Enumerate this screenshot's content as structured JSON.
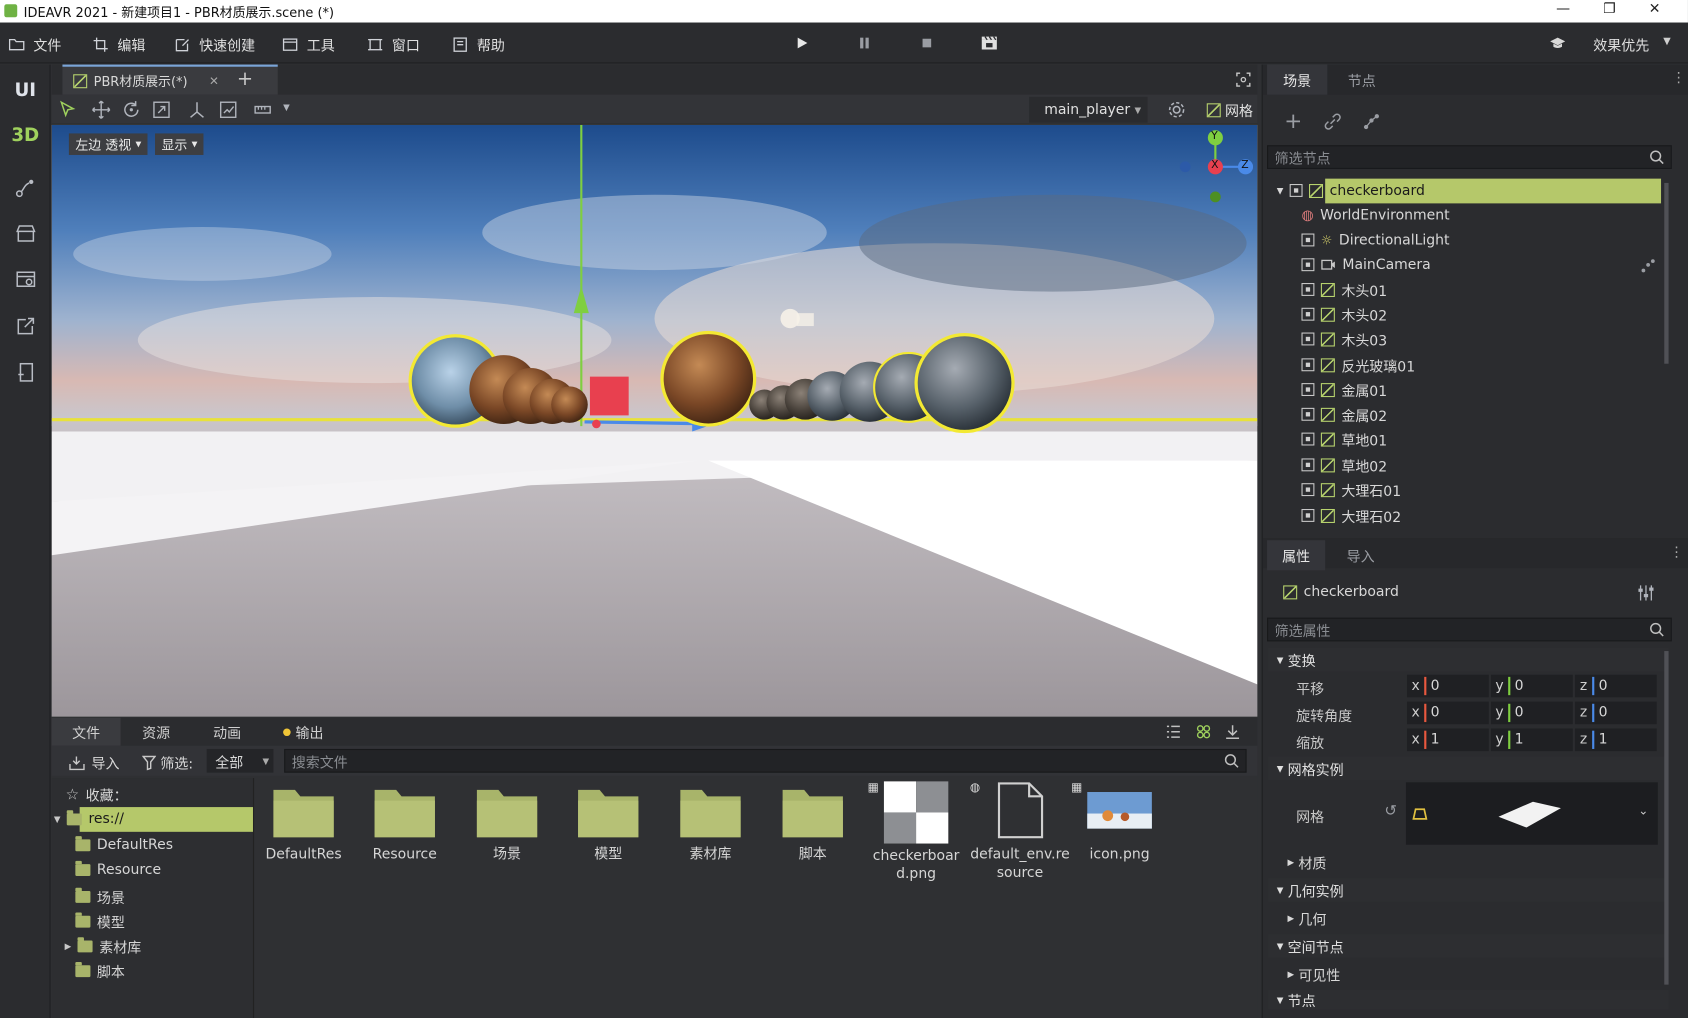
{
  "window": {
    "title": "IDEAVR 2021 - 新建项目1 - PBR材质展示.scene (*)",
    "minimize": "—",
    "maximize": "❐",
    "close": "✕"
  },
  "menu": {
    "items": [
      "文件",
      "编辑",
      "快速创建",
      "工具",
      "窗口",
      "帮助"
    ],
    "render_mode": "效果优先"
  },
  "leftbar": {
    "ui_label": "UI",
    "3d_label": "3D"
  },
  "editor": {
    "tab_label": "PBR材质展示(*)",
    "tab_close": "✕",
    "add_tab": "+",
    "player": "main_player",
    "grid_label": "网格",
    "view_mode": "左边 透视",
    "display_label": "显示",
    "gizmo": {
      "y": "Y",
      "x": "X",
      "z": "Z"
    }
  },
  "bottom": {
    "tabs": [
      "文件",
      "资源",
      "动画",
      "输出"
    ],
    "import_label": "导入",
    "filter_label": "筛选:",
    "filter_value": "全部",
    "search_placeholder": "搜索文件",
    "favorites_label": "收藏：",
    "tree": [
      "res://",
      "DefaultRes",
      "Resource",
      "场景",
      "模型",
      "素材库",
      "脚本"
    ],
    "files": [
      {
        "name": "DefaultRes",
        "kind": "folder"
      },
      {
        "name": "Resource",
        "kind": "folder"
      },
      {
        "name": "场景",
        "kind": "folder"
      },
      {
        "name": "模型",
        "kind": "folder"
      },
      {
        "name": "素材库",
        "kind": "folder"
      },
      {
        "name": "脚本",
        "kind": "folder"
      },
      {
        "name": "checkerboard.png",
        "kind": "image"
      },
      {
        "name": "default_env.resource",
        "kind": "resource"
      },
      {
        "name": "icon.png",
        "kind": "image"
      }
    ]
  },
  "scene": {
    "tabs": [
      "场景",
      "节点"
    ],
    "filter_placeholder": "筛选节点",
    "nodes": [
      {
        "name": "checkerboard",
        "icon": "mesh-icon",
        "selected": true
      },
      {
        "name": "WorldEnvironment",
        "icon": "globe-icon"
      },
      {
        "name": "DirectionalLight",
        "icon": "sun-icon"
      },
      {
        "name": "MainCamera",
        "icon": "camera-icon"
      },
      {
        "name": "木头01",
        "icon": "mesh-icon"
      },
      {
        "name": "木头02",
        "icon": "mesh-icon"
      },
      {
        "name": "木头03",
        "icon": "mesh-icon"
      },
      {
        "name": "反光玻璃01",
        "icon": "mesh-icon"
      },
      {
        "name": "金属01",
        "icon": "mesh-icon"
      },
      {
        "name": "金属02",
        "icon": "mesh-icon"
      },
      {
        "name": "草地01",
        "icon": "mesh-icon"
      },
      {
        "name": "草地02",
        "icon": "mesh-icon"
      },
      {
        "name": "大理石01",
        "icon": "mesh-icon"
      },
      {
        "name": "大理石02",
        "icon": "mesh-icon"
      }
    ]
  },
  "inspector": {
    "tabs": [
      "属性",
      "导入"
    ],
    "object_name": "checkerboard",
    "filter_placeholder": "筛选属性",
    "sections": {
      "transform": "变换",
      "mesh_instance": "网格实例",
      "material": "材质",
      "geometry_instance": "几何实例",
      "geometry": "几何",
      "spatial": "空间节点",
      "visibility": "可见性",
      "node": "节点"
    },
    "props": {
      "translation": {
        "label": "平移",
        "x": "0",
        "y": "0",
        "z": "0"
      },
      "rotation": {
        "label": "旋转角度",
        "x": "0",
        "y": "0",
        "z": "0"
      },
      "scale": {
        "label": "缩放",
        "x": "1",
        "y": "1",
        "z": "1"
      }
    },
    "mesh_label": "网格",
    "axis": {
      "x": "x",
      "y": "y",
      "z": "z"
    }
  },
  "colors": {
    "accent": "#b8d46e",
    "selection": "#b5c86a",
    "axis_x": "#e8583f",
    "axis_y": "#7fcf40",
    "axis_z": "#4a8ae8"
  }
}
